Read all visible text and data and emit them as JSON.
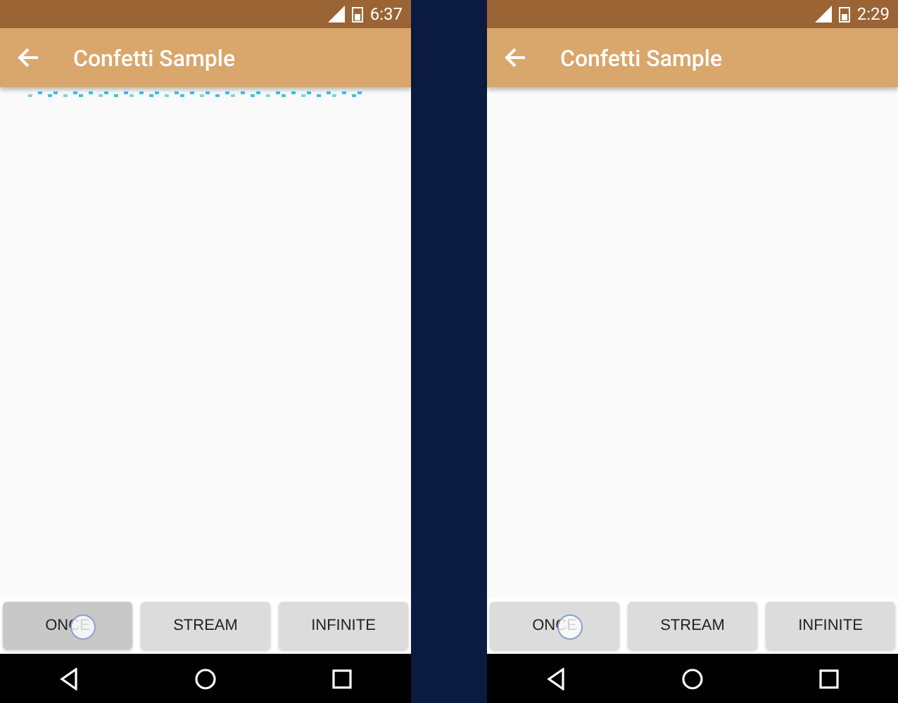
{
  "screens": [
    {
      "status_time": "6:37",
      "title": "Confetti Sample",
      "confetti_visible": true,
      "buttons": [
        {
          "label": "ONCE",
          "pressed": true,
          "touched": true
        },
        {
          "label": "STREAM",
          "pressed": false,
          "touched": false
        },
        {
          "label": "INFINITE",
          "pressed": false,
          "touched": false
        }
      ]
    },
    {
      "status_time": "2:29",
      "title": "Confetti Sample",
      "buttons": [
        {
          "label": "ONCE",
          "pressed": false,
          "touched": true
        },
        {
          "label": "STREAM",
          "pressed": false,
          "touched": false
        },
        {
          "label": "INFINITE",
          "pressed": false,
          "touched": false
        }
      ]
    }
  ]
}
